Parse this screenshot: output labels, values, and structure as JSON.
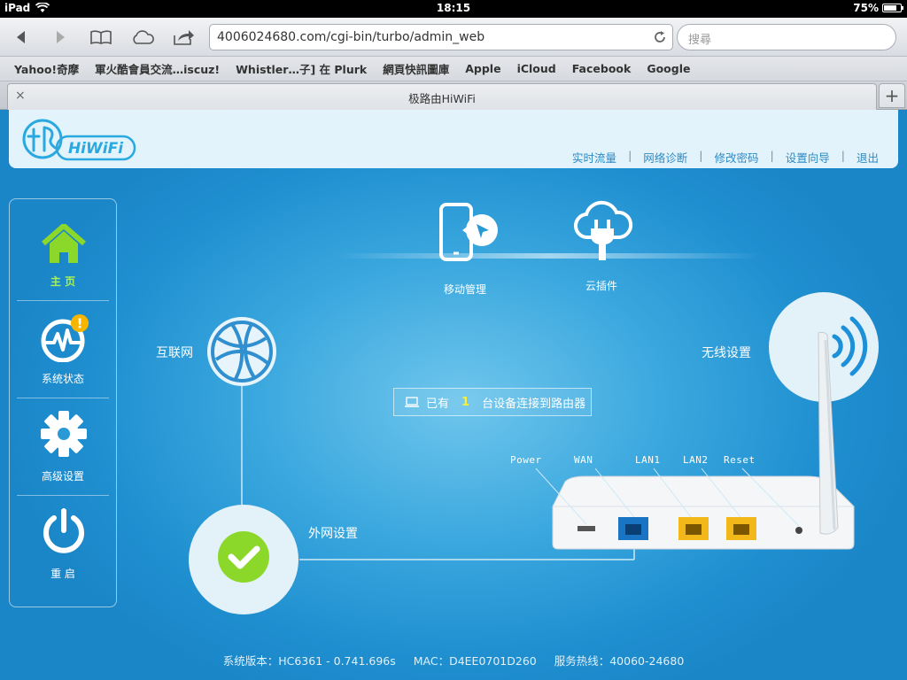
{
  "status": {
    "device": "iPad",
    "time": "18:15",
    "battery": "75%",
    "battery_level": 0.75
  },
  "browser": {
    "url": "4006024680.com/cgi-bin/turbo/admin_web",
    "search_placeholder": "搜尋",
    "bookmarks": [
      "Yahoo!奇摩",
      "軍火酷會員交流…iscuz!",
      "Whistler…子] 在 Plurk",
      "網頁快訊圖庫",
      "Apple",
      "iCloud",
      "Facebook",
      "Google"
    ],
    "tab_title": "极路由HiWiFi",
    "tab_close": "×",
    "new_tab": "+"
  },
  "header": {
    "logo_text": "HiWiFi",
    "nav": [
      "实时流量",
      "网络诊断",
      "修改密码",
      "设置向导",
      "退出"
    ],
    "separator": "|"
  },
  "sidebar": [
    {
      "label": "主 页",
      "icon": "home-icon"
    },
    {
      "label": "系统状态",
      "icon": "pulse-icon",
      "alert": "!"
    },
    {
      "label": "高级设置",
      "icon": "gear-icon"
    },
    {
      "label": "重 启",
      "icon": "power-icon"
    }
  ],
  "main": {
    "mobile_label": "移动管理",
    "plugin_label": "云插件",
    "internet_label": "互联网",
    "wireless_label": "无线设置",
    "wan_label": "外网设置",
    "devices": {
      "prefix": "已有",
      "count": "1",
      "suffix": "台设备连接到路由器"
    },
    "ports": [
      "Power",
      "WAN",
      "LAN1",
      "LAN2",
      "Reset"
    ]
  },
  "footer": {
    "version": "系统版本：HC6361 - 0.741.696s",
    "mac": "MAC：D4EE0701D260",
    "hotline": "服务热线：40060-24680"
  },
  "colors": {
    "page_blue": "#1f8fd0",
    "accent_green": "#8cd82a",
    "port_blue": "#1a74c4",
    "port_yellow": "#f2b81a"
  }
}
